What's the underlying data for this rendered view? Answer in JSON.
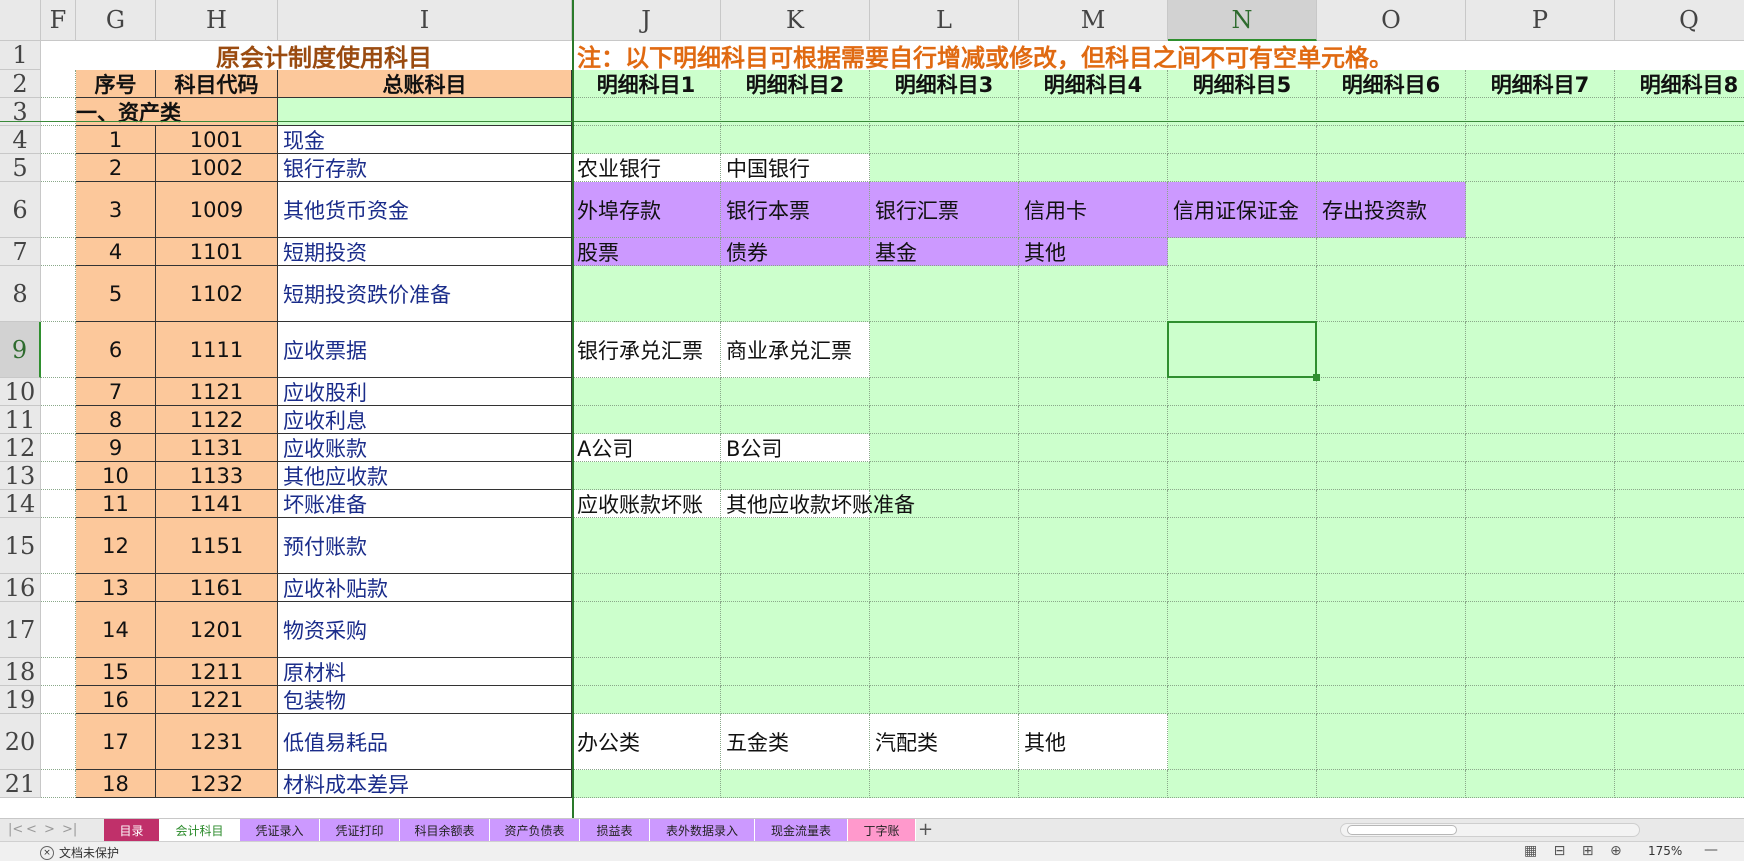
{
  "sheet": {
    "title_row1_left": "原会计制度使用科目",
    "title_row1_note": "注：以下明细科目可根据需要自行增减或修改，但科目之间不可有空单元格。",
    "col_headers": [
      "F",
      "G",
      "H",
      "I",
      "J",
      "K",
      "L",
      "M",
      "N",
      "O",
      "P",
      "Q"
    ],
    "active_column": "N",
    "active_row": "9",
    "row_headers": [
      "1",
      "2",
      "3",
      "4",
      "5",
      "6",
      "7",
      "8",
      "9",
      "10",
      "11",
      "12",
      "13",
      "14",
      "15",
      "16",
      "17",
      "18",
      "19",
      "20",
      "21"
    ],
    "header_row": {
      "seq": "序号",
      "code": "科目代码",
      "account": "总账科目",
      "details": [
        "明细科目1",
        "明细科目2",
        "明细科目3",
        "明细科目4",
        "明细科目5",
        "明细科目6",
        "明细科目7",
        "明细科目8"
      ]
    },
    "section_asset": "一、资产类",
    "rows": [
      {
        "seq": "1",
        "code": "1001",
        "name": "现金",
        "details": []
      },
      {
        "seq": "2",
        "code": "1002",
        "name": "银行存款",
        "details": [
          "农业银行",
          "中国银行"
        ]
      },
      {
        "seq": "3",
        "code": "1009",
        "name": "其他货币资金",
        "details": [
          "外埠存款",
          "银行本票",
          "银行汇票",
          "信用卡",
          "信用证保证金",
          "存出投资款"
        ]
      },
      {
        "seq": "4",
        "code": "1101",
        "name": "短期投资",
        "details": [
          "股票",
          "债券",
          "基金",
          "其他"
        ]
      },
      {
        "seq": "5",
        "code": "1102",
        "name": "短期投资跌价准备",
        "details": []
      },
      {
        "seq": "6",
        "code": "1111",
        "name": "应收票据",
        "details": [
          "银行承兑汇票",
          "商业承兑汇票"
        ]
      },
      {
        "seq": "7",
        "code": "1121",
        "name": "应收股利",
        "details": []
      },
      {
        "seq": "8",
        "code": "1122",
        "name": "应收利息",
        "details": []
      },
      {
        "seq": "9",
        "code": "1131",
        "name": "应收账款",
        "details": [
          "A公司",
          "B公司"
        ]
      },
      {
        "seq": "10",
        "code": "1133",
        "name": "其他应收款",
        "details": []
      },
      {
        "seq": "11",
        "code": "1141",
        "name": "坏账准备",
        "details": [
          "应收账款坏账",
          "其他应收款坏账准备"
        ]
      },
      {
        "seq": "12",
        "code": "1151",
        "name": "预付账款",
        "details": []
      },
      {
        "seq": "13",
        "code": "1161",
        "name": "应收补贴款",
        "details": []
      },
      {
        "seq": "14",
        "code": "1201",
        "name": "物资采购",
        "details": []
      },
      {
        "seq": "15",
        "code": "1211",
        "name": "原材料",
        "details": []
      },
      {
        "seq": "16",
        "code": "1221",
        "name": "包装物",
        "details": []
      },
      {
        "seq": "17",
        "code": "1231",
        "name": "低值易耗品",
        "details": [
          "办公类",
          "五金类",
          "汽配类",
          "其他"
        ]
      },
      {
        "seq": "18",
        "code": "1232",
        "name": "材料成本差异",
        "details": []
      }
    ]
  },
  "tabs": [
    {
      "label": "目录",
      "color": "#c0306a",
      "text": "#ffffff"
    },
    {
      "label": "会计科目",
      "color": "#ffffff",
      "text": "#2a8a2a",
      "active": true
    },
    {
      "label": "凭证录入",
      "color": "#cc99ff",
      "text": "#222222"
    },
    {
      "label": "凭证打印",
      "color": "#cc99ff",
      "text": "#222222"
    },
    {
      "label": "科目余额表",
      "color": "#cc99ff",
      "text": "#222222"
    },
    {
      "label": "资产负债表",
      "color": "#cc99ff",
      "text": "#222222"
    },
    {
      "label": "损益表",
      "color": "#cc99ff",
      "text": "#222222"
    },
    {
      "label": "表外数据录入",
      "color": "#cc99ff",
      "text": "#222222"
    },
    {
      "label": "现金流量表",
      "color": "#cc99ff",
      "text": "#222222"
    },
    {
      "label": "丁字账",
      "color": "#ff99cc",
      "text": "#222222"
    }
  ],
  "tab_nav": [
    "|<",
    "<",
    ">",
    ">|"
  ],
  "add_tab_label": "+",
  "status": {
    "protection": "文档未保护",
    "view_icons": "▦ ⊟ ⊞ ⊕",
    "zoom": "175%",
    "zoom_minus": "—"
  },
  "colors": {
    "orange": "#fcc89b",
    "green": "#ccffcc",
    "purple": "#cc99ff",
    "link_text": "#1a2c8a",
    "note_text": "#e06a12",
    "title_text": "#9a4b10",
    "selection": "#2f8f2f"
  }
}
